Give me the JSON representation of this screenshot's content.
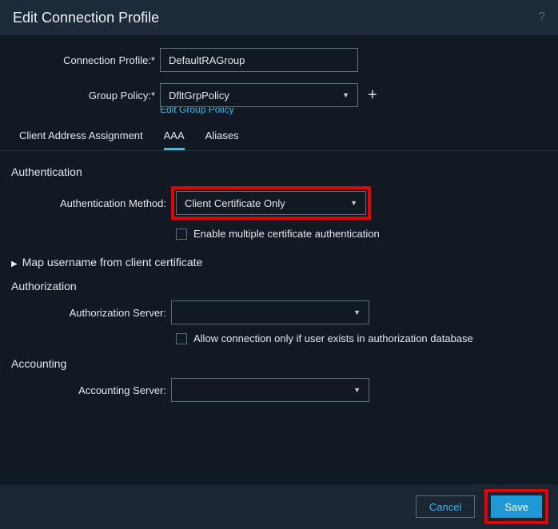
{
  "title": "Edit Connection Profile",
  "helpIcon": "help-icon",
  "fields": {
    "connProfileLabel": "Connection Profile:*",
    "connProfileValue": "DefaultRAGroup",
    "groupPolicyLabel": "Group Policy:*",
    "groupPolicyValue": "DfltGrpPolicy",
    "editGroupPolicy": "Edit Group Policy"
  },
  "tabs": [
    "Client Address Assignment",
    "AAA",
    "Aliases"
  ],
  "activeTab": 1,
  "authentication": {
    "heading": "Authentication",
    "methodLabel": "Authentication Method:",
    "methodValue": "Client Certificate Only",
    "enableMultiLabel": "Enable multiple certificate authentication"
  },
  "mapUsername": "Map username from client certificate",
  "authorization": {
    "heading": "Authorization",
    "serverLabel": "Authorization Server:",
    "serverValue": "",
    "allowLabel": "Allow connection only if user exists in authorization database"
  },
  "accounting": {
    "heading": "Accounting",
    "serverLabel": "Accounting Server:",
    "serverValue": ""
  },
  "buttons": {
    "cancel": "Cancel",
    "save": "Save"
  }
}
